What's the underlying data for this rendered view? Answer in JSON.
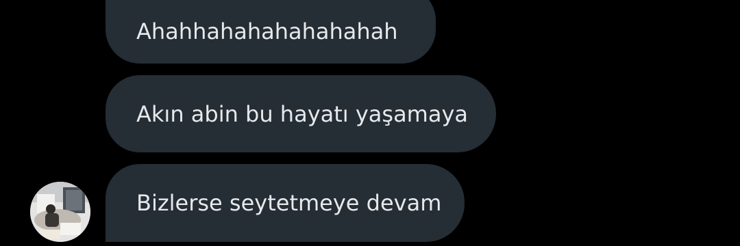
{
  "chat": {
    "messages": [
      {
        "text": "Ahahhahahahahahahah"
      },
      {
        "text": "Akın abin bu hayatı yaşamaya"
      },
      {
        "text": "Bizlerse seytetmeye devam"
      }
    ]
  },
  "avatar": {
    "icon": "user-photo-avatar"
  },
  "colors": {
    "background": "#000000",
    "bubble": "#252d35",
    "text": "#e7e9ea"
  }
}
